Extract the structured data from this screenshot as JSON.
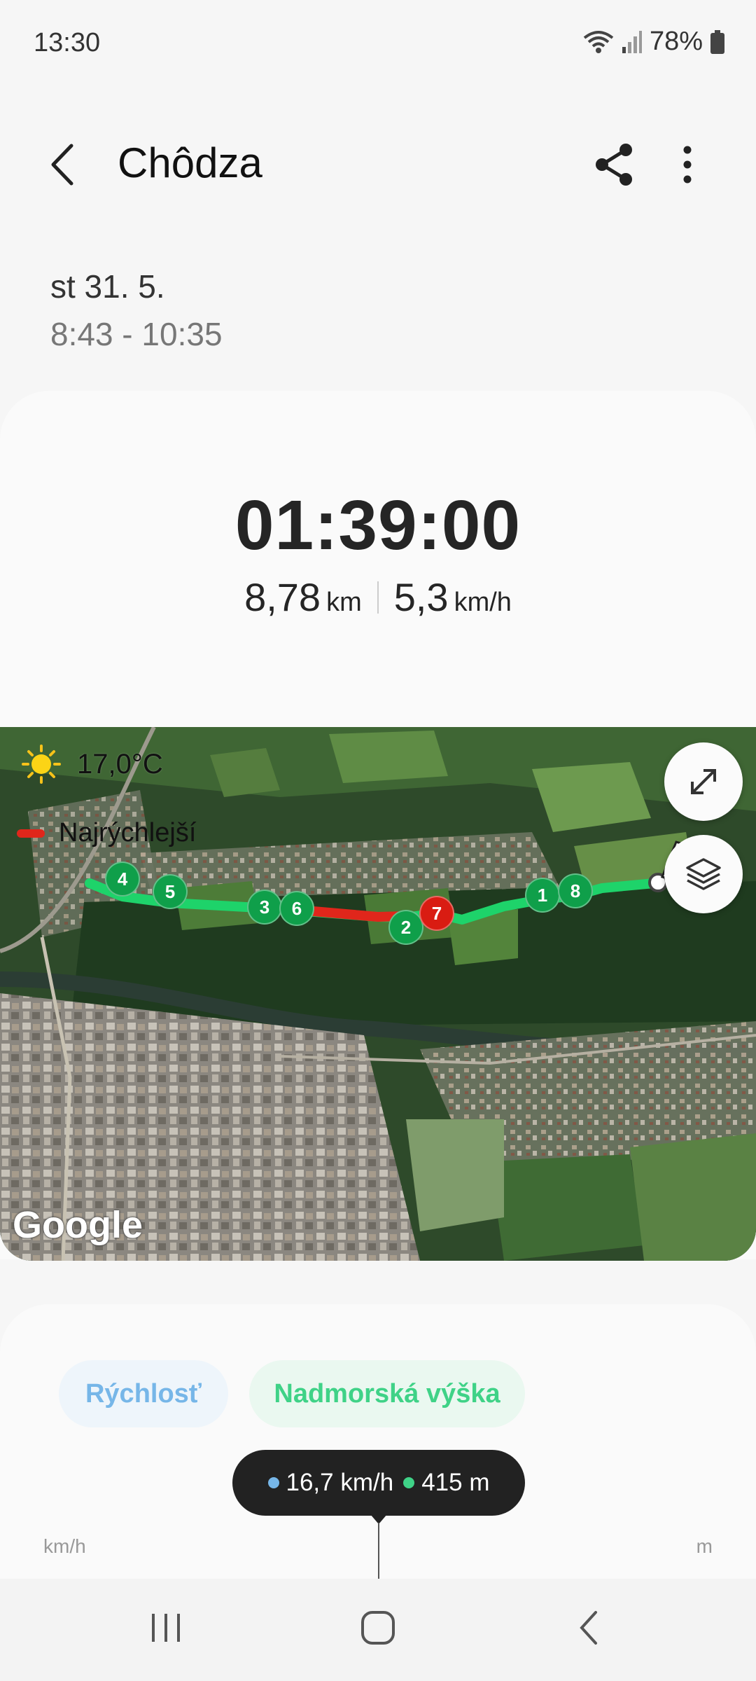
{
  "status": {
    "time": "13:30",
    "battery": "78%",
    "icons": [
      "wifi-icon",
      "signal-icon",
      "battery-icon"
    ]
  },
  "header": {
    "title": "Chôdza",
    "actions": [
      "back-icon",
      "share-icon",
      "more-icon"
    ]
  },
  "session": {
    "date": "st 31. 5.",
    "time_range": "8:43 - 10:35"
  },
  "summary": {
    "duration": "01:39:00",
    "distance_value": "8,78",
    "distance_unit": "km",
    "speed_value": "5,3",
    "speed_unit": "km/h"
  },
  "map": {
    "temperature": "17,0°C",
    "weather_icon": "sun-icon",
    "legend_label": "Najrýchlejší",
    "legend_color": "#e0261b",
    "route_color": "#1ed36a",
    "markers": [
      "1",
      "2",
      "3",
      "4",
      "5",
      "6",
      "7",
      "8"
    ],
    "fastest_marker": "7",
    "attribution": "Google"
  },
  "chart": {
    "tabs": [
      "Rýchlosť",
      "Nadmorská výška"
    ],
    "tooltip_speed": "16,7 km/h",
    "tooltip_altitude": "415 m",
    "speed_color": "#76b6e8",
    "altitude_color": "#3fd287",
    "left_axis_unit": "km/h",
    "right_axis_unit": "m"
  },
  "navigation": {
    "buttons": [
      "recents-icon",
      "home-icon",
      "back-nav-icon"
    ]
  }
}
